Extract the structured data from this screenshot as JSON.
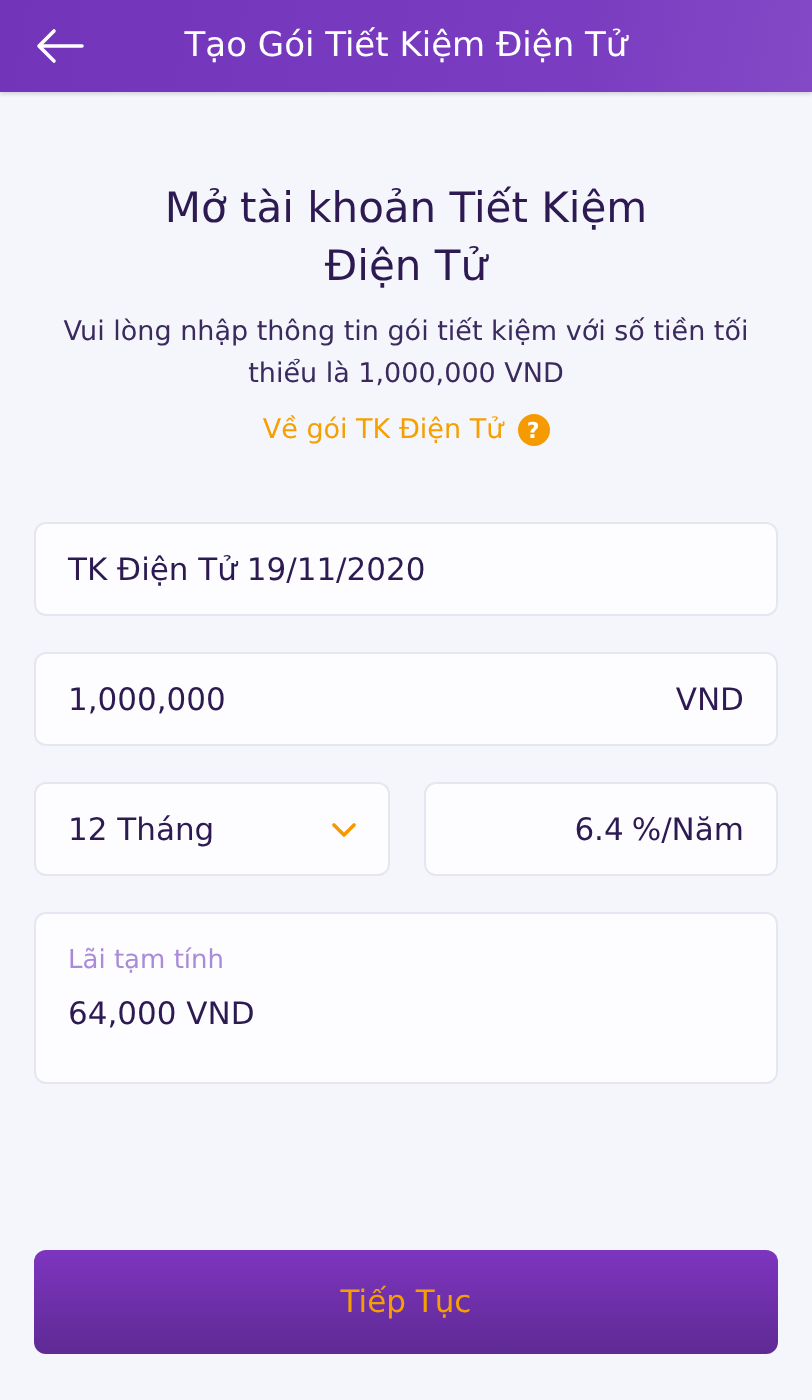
{
  "header": {
    "title": "Tạo Gói Tiết Kiệm Điện Tử"
  },
  "heading": {
    "lines": [
      "Mở tài khoản Tiết Kiệm",
      "Điện Tử"
    ]
  },
  "description": "Vui lòng nhập thông tin gói tiết kiệm với số tiền tối thiểu là 1,000,000 VND",
  "info_link": {
    "label": "Về gói TK Điện Tử",
    "help": "?"
  },
  "name_field": {
    "value": "TK Điện Tử 19/11/2020"
  },
  "amount_field": {
    "value": "1,000,000",
    "unit": "VND"
  },
  "term_select": {
    "value": "12 Tháng"
  },
  "rate_field": {
    "value": "6.4",
    "unit": "%/Năm"
  },
  "interest_field": {
    "label": "Lãi tạm tính",
    "value": "64,000 VND"
  },
  "continue_button": {
    "label": "Tiếp Tục"
  }
}
